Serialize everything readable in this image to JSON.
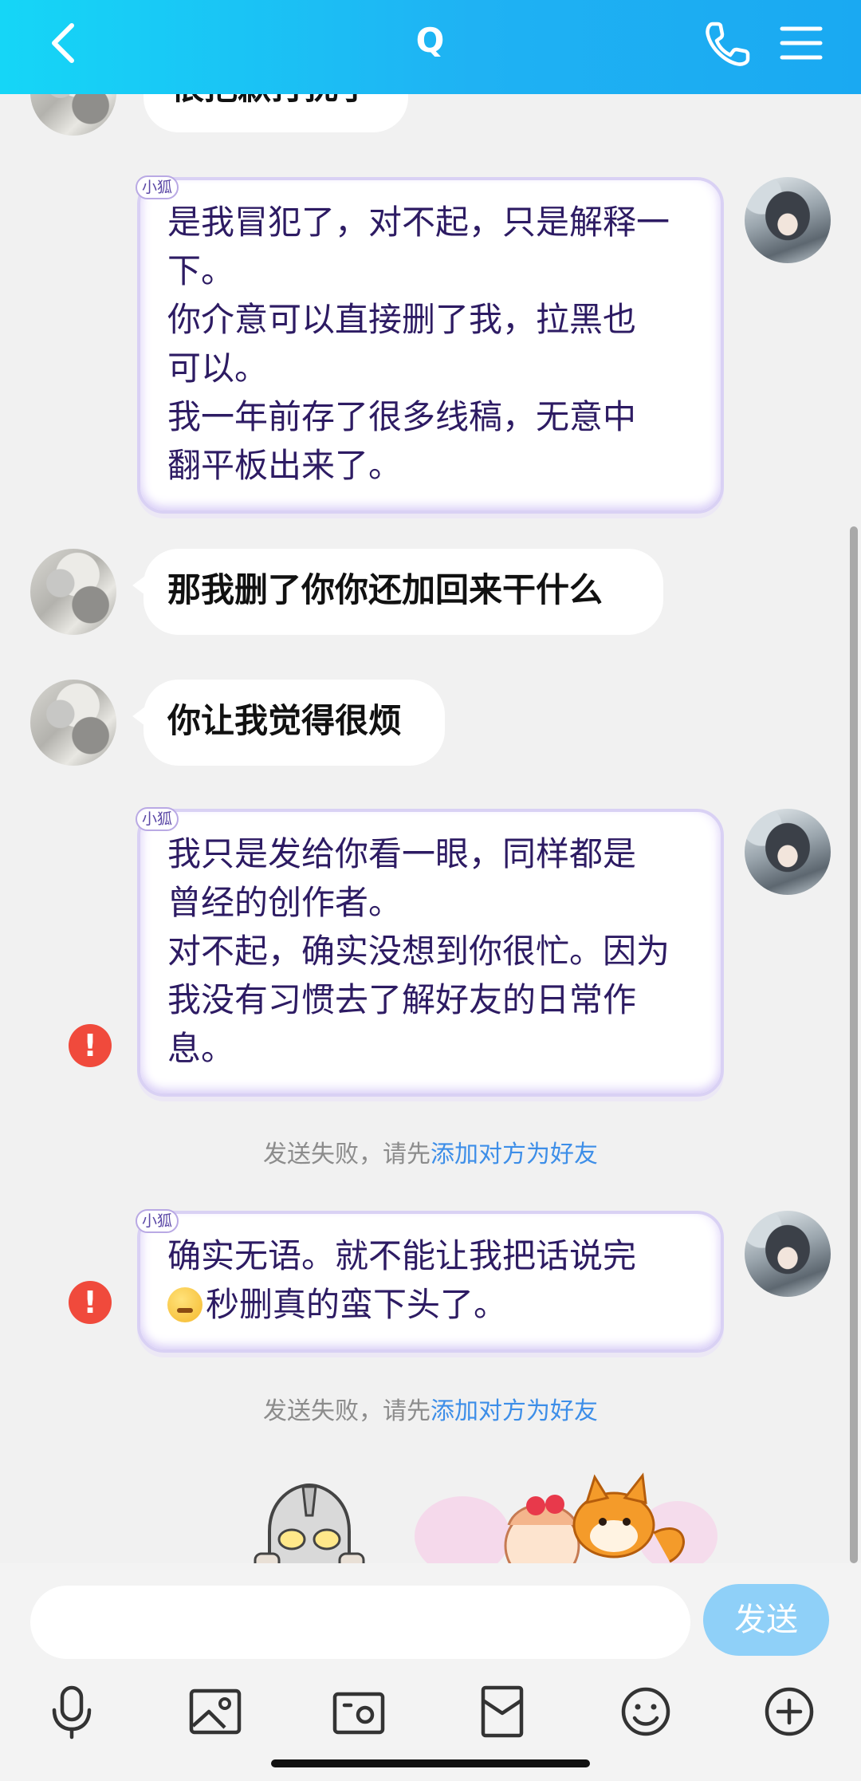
{
  "header": {
    "title": "Q"
  },
  "messages": [
    {
      "side": "left",
      "type": "text",
      "text": "很抱歉打扰了"
    },
    {
      "side": "right",
      "type": "fox",
      "tag": "小狐",
      "lines": [
        "是我冒犯了，对不起，只是解释一",
        "下。",
        "你介意可以直接删了我，拉黑也",
        "可以。",
        "我一年前存了很多线稿，无意中",
        "翻平板出来了。"
      ]
    },
    {
      "side": "left",
      "type": "text",
      "text": "那我删了你你还加回来干什么"
    },
    {
      "side": "left",
      "type": "text",
      "text": "你让我觉得很烦"
    },
    {
      "side": "right",
      "type": "fox",
      "tag": "小狐",
      "lines": [
        "我只是发给你看一眼，同样都是",
        "曾经的创作者。",
        "对不起，确实没想到你很忙。因为",
        "我没有习惯去了解好友的日常作",
        "息。"
      ],
      "failed": true
    },
    {
      "side": "right",
      "type": "fox",
      "tag": "小狐",
      "lines": [
        "确实无语。就不能让我把话说完",
        "秒删真的蛮下头了。"
      ],
      "failed": true
    }
  ],
  "failed_notice": {
    "prefix": "发送失败，请先",
    "link": "添加对方为好友"
  },
  "error_glyph": "!",
  "input": {
    "placeholder": "",
    "value": ""
  },
  "send_label": "发送",
  "colors": {
    "header_gradient_start": "#15d6f7",
    "header_gradient_end": "#1aa9f2",
    "send_button": "#8fd0f8",
    "error": "#f04a3c",
    "link": "#3d8ee8",
    "fox_text": "#2d1b63"
  },
  "icons": {
    "header": [
      "back-icon",
      "phone-icon",
      "menu-icon"
    ],
    "toolbar": [
      "microphone-icon",
      "image-icon",
      "camera-icon",
      "red-packet-icon",
      "emoji-icon",
      "plus-icon"
    ]
  }
}
